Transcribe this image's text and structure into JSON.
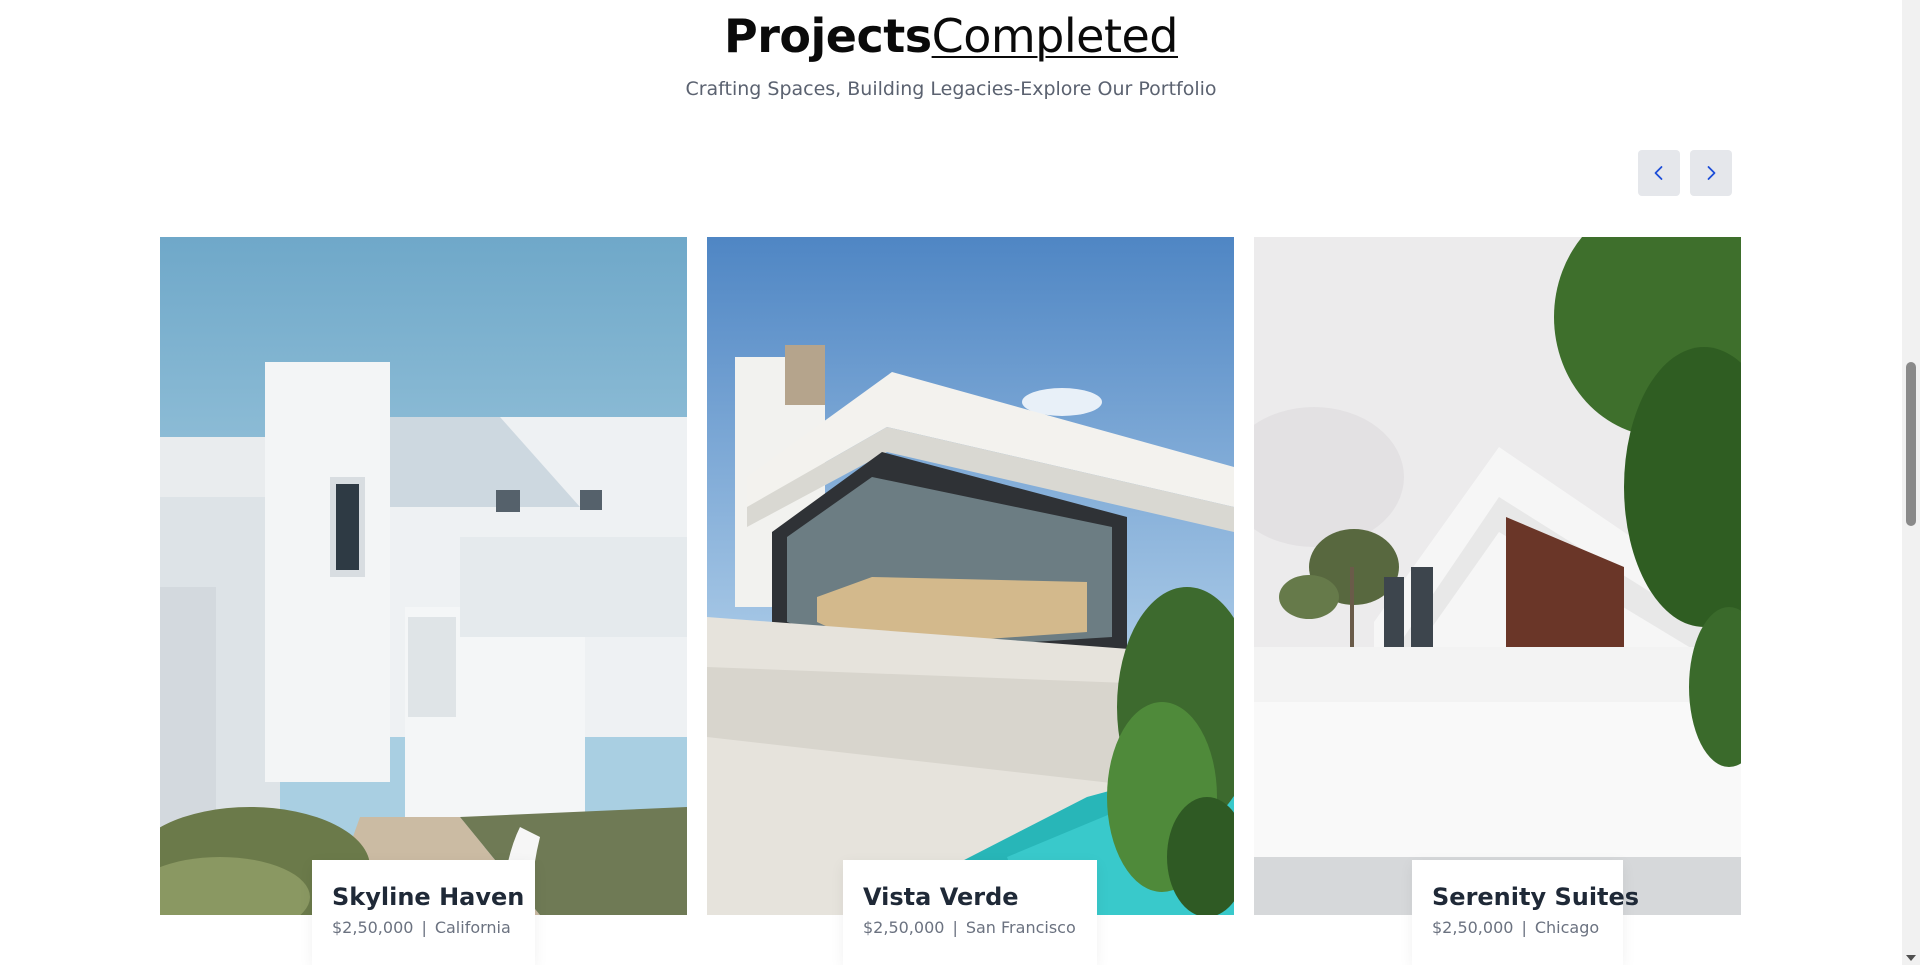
{
  "section": {
    "title_bold": "Projects",
    "title_light": "Completed",
    "subtitle": "Crafting Spaces, Building Legacies-Explore Our Portfolio"
  },
  "carousel": {
    "prev_icon": "chevron-left-icon",
    "next_icon": "chevron-right-icon",
    "accent_color": "#1d4ed8"
  },
  "projects": [
    {
      "name": "Skyline Haven",
      "price": "$2,50,000",
      "location": "California"
    },
    {
      "name": "Vista Verde",
      "price": "$2,50,000",
      "location": "San Francisco"
    },
    {
      "name": "Serenity Suites",
      "price": "$2,50,000",
      "location": "Chicago"
    }
  ],
  "separator": "|"
}
